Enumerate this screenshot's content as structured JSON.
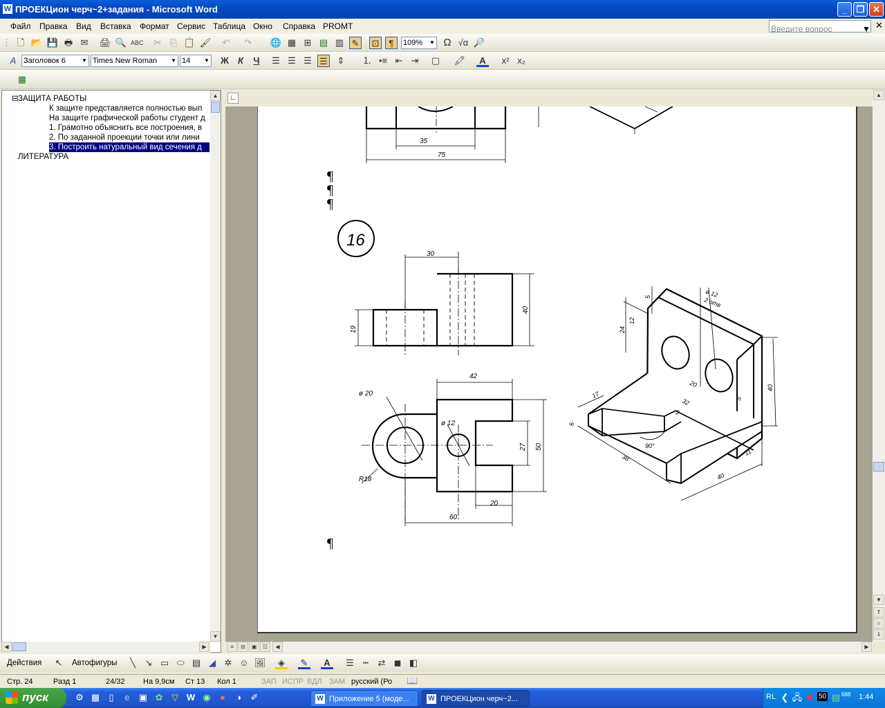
{
  "window": {
    "title": "ПРОЕКЦион черч~2+задания - Microsoft Word"
  },
  "menu": [
    "Файл",
    "Правка",
    "Вид",
    "Вставка",
    "Формат",
    "Сервис",
    "Таблица",
    "Окно",
    "Справка",
    "PROMT"
  ],
  "help_search": {
    "placeholder": "Введите вопрос"
  },
  "toolbar": {
    "zoom": "109%",
    "style": "Заголовок 6",
    "font": "Times New Roman",
    "size": "14"
  },
  "format_buttons": {
    "bold": "Ж",
    "italic": "К",
    "underline": "Ч"
  },
  "nav": {
    "heading": "ЗАЩИТА РАБОТЫ",
    "items": [
      "К защите представляется полностью вып",
      "На защите графической работы студент д",
      "1. Грамотно объяснить все построения, в",
      "2. По заданной проекции точки или лини",
      "3. Построить натуральный вид сечения д"
    ],
    "literature": "ЛИТЕРАТУРА"
  },
  "document": {
    "pilcrow": "¶",
    "task_number": "16"
  },
  "drawing": {
    "top_dims": [
      "35",
      "75"
    ],
    "front_dims": [
      "30",
      "40",
      "19"
    ],
    "plan_dims": [
      "42",
      "ø 20",
      "ø 12",
      "27",
      "50",
      "R18",
      "20",
      "60"
    ],
    "iso_dims": [
      "ø 12",
      "2 отв",
      "5",
      "12",
      "24",
      "20",
      "40",
      "5",
      "17",
      "32",
      "5",
      "6",
      "90°",
      "38",
      "11",
      "40",
      "20"
    ]
  },
  "drawbar": {
    "actions": "Действия",
    "autoshapes": "Автофигуры"
  },
  "status": {
    "page": "Стр. 24",
    "section": "Разд 1",
    "pages": "24/32",
    "at": "На 9,9см",
    "line": "Ст 13",
    "col": "Кол 1",
    "rec": "ЗАП",
    "trk": "ИСПР",
    "ext": "ВДЛ",
    "ovr": "ЗАМ",
    "lang": "русский (Ро"
  },
  "taskbar": {
    "start": "пуск",
    "tasks": [
      "Приложение 5 (моде...",
      "ПРОЕКЦион черч~2..."
    ],
    "lang": "RL",
    "clock": "1:44",
    "tray_num": "50",
    "tray_small": "688"
  },
  "colors": {
    "titlebar": "#0549c0",
    "taskbar": "#245edb",
    "start": "#2f8c2f",
    "selection": "#000080"
  }
}
